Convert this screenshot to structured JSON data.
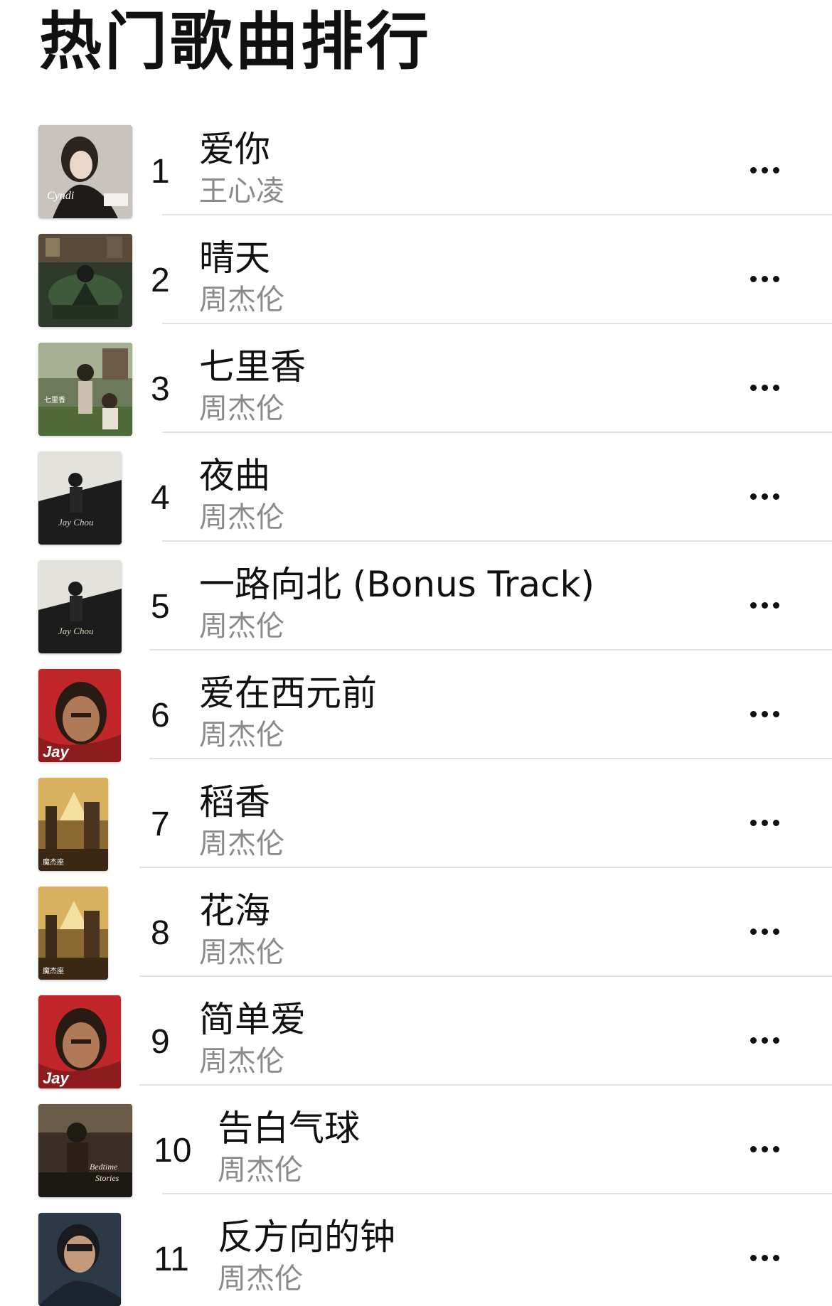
{
  "header": {
    "title": "热门歌曲排行"
  },
  "songs": [
    {
      "rank": "1",
      "title": "爱你",
      "artist": "王心凌",
      "cover_icon": "album-cover-woman-portrait"
    },
    {
      "rank": "2",
      "title": "晴天",
      "artist": "周杰伦",
      "cover_icon": "album-cover-green-room"
    },
    {
      "rank": "3",
      "title": "七里香",
      "artist": "周杰伦",
      "cover_icon": "album-cover-garden"
    },
    {
      "rank": "4",
      "title": "夜曲",
      "artist": "周杰伦",
      "cover_icon": "album-cover-piano"
    },
    {
      "rank": "5",
      "title": "一路向北 (Bonus Track)",
      "artist": "周杰伦",
      "cover_icon": "album-cover-piano"
    },
    {
      "rank": "6",
      "title": "爱在西元前",
      "artist": "周杰伦",
      "cover_icon": "album-cover-red-hood"
    },
    {
      "rank": "7",
      "title": "稻香",
      "artist": "周杰伦",
      "cover_icon": "album-cover-castle"
    },
    {
      "rank": "8",
      "title": "花海",
      "artist": "周杰伦",
      "cover_icon": "album-cover-castle"
    },
    {
      "rank": "9",
      "title": "简单爱",
      "artist": "周杰伦",
      "cover_icon": "album-cover-red-hood"
    },
    {
      "rank": "10",
      "title": "告白气球",
      "artist": "周杰伦",
      "cover_icon": "album-cover-bedtime-stories"
    },
    {
      "rank": "11",
      "title": "反方向的钟",
      "artist": "周杰伦",
      "cover_icon": "album-cover-portrait-blue"
    }
  ],
  "more_icon": "more-horizontal-icon",
  "colors": {
    "primary_text": "#111111",
    "secondary_text": "#8a8a8a",
    "divider": "#e2e2e2",
    "background": "#ffffff"
  }
}
